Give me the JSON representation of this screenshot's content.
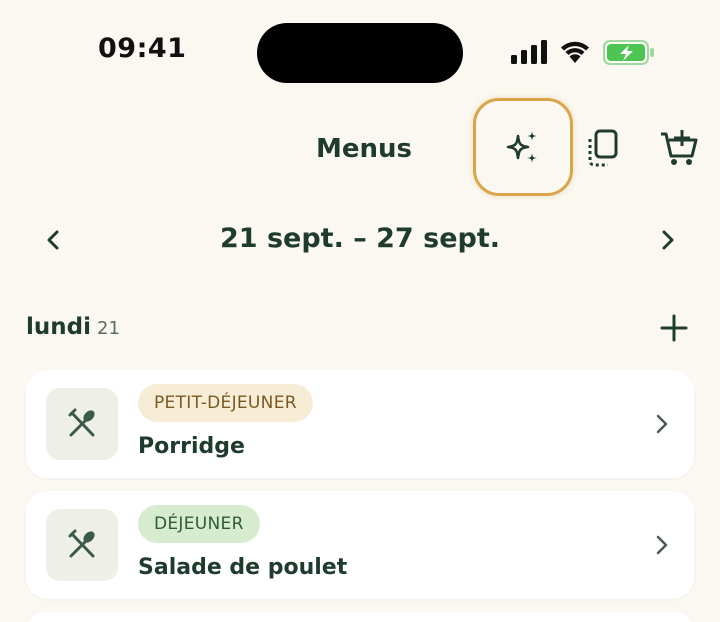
{
  "status_bar": {
    "time": "09:41"
  },
  "header": {
    "title": "Menus",
    "icons": [
      "sparkles-icon",
      "copy-icon",
      "cart-add-icon"
    ],
    "highlight_color": "#d9a54a"
  },
  "week": {
    "range": "21 sept. – 27 sept."
  },
  "day": {
    "name": "lundi",
    "number": "21"
  },
  "meals": [
    {
      "tag": "PETIT-DÉJEUNER",
      "tag_bg": "#f7ecd6",
      "tag_color": "#7a5a22",
      "name": "Porridge",
      "icon": "utensils-icon"
    },
    {
      "tag": "DÉJEUNER",
      "tag_bg": "#d7ecce",
      "tag_color": "#2e5b35",
      "name": "Salade de poulet",
      "icon": "utensils-icon"
    }
  ],
  "colors": {
    "background": "#faf8f1",
    "primary_text": "#1f3b2e",
    "card": "#ffffff"
  }
}
